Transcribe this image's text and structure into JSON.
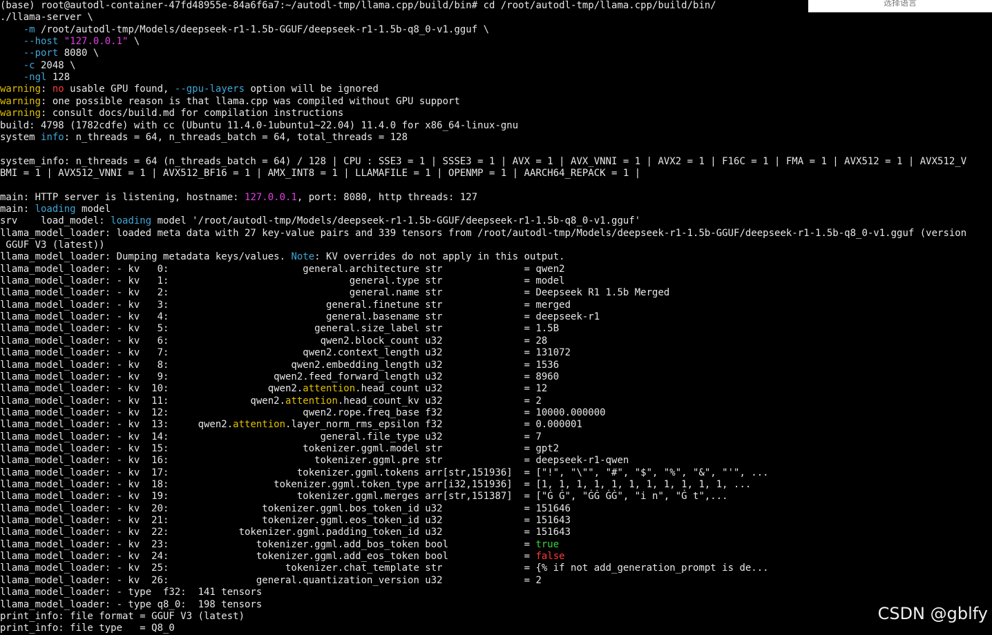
{
  "palette": {
    "default": "#e8e8e8",
    "cyan": "#3fa7d6",
    "yellow": "#e0c000",
    "magenta": "#e040e0",
    "green": "#36d43a",
    "red": "#ff3b3b",
    "orange": "#e08820"
  },
  "language_box_label": "选择语言",
  "watermark": "CSDN @gblfy",
  "lines": [
    [
      {
        "t": "(base) root@autodl-container-47fd48955e-84a6f6a7:~/autodl-tmp/llama.cpp/build/bin# cd /root/autodl-tmp/llama.cpp/build/bin/"
      }
    ],
    [
      {
        "t": "./llama-server \\"
      }
    ],
    [
      {
        "t": "    "
      },
      {
        "t": "-m",
        "c": "cyan"
      },
      {
        "t": " /root/autodl-tmp/Models/deepseek-r1-1.5b-GGUF/deepseek-r1-1.5b-q8_0-v1.gguf \\"
      }
    ],
    [
      {
        "t": "    "
      },
      {
        "t": "--host",
        "c": "cyan"
      },
      {
        "t": " "
      },
      {
        "t": "\"127.0.0.1\"",
        "c": "magenta"
      },
      {
        "t": " \\"
      }
    ],
    [
      {
        "t": "    "
      },
      {
        "t": "--port",
        "c": "cyan"
      },
      {
        "t": " 8080 \\"
      }
    ],
    [
      {
        "t": "    "
      },
      {
        "t": "-c",
        "c": "cyan"
      },
      {
        "t": " 2048 \\"
      }
    ],
    [
      {
        "t": "    "
      },
      {
        "t": "-ngl",
        "c": "cyan"
      },
      {
        "t": " 128"
      }
    ],
    [
      {
        "t": "warning",
        "c": "yellow"
      },
      {
        "t": ": "
      },
      {
        "t": "no",
        "c": "red"
      },
      {
        "t": " usable GPU found, "
      },
      {
        "t": "--gpu-layers",
        "c": "cyan"
      },
      {
        "t": " option will be ignored"
      }
    ],
    [
      {
        "t": "warning",
        "c": "yellow"
      },
      {
        "t": ": one possible reason is that llama.cpp was compiled without GPU support"
      }
    ],
    [
      {
        "t": "warning",
        "c": "yellow"
      },
      {
        "t": ": consult docs/build.md for compilation instructions"
      }
    ],
    [
      {
        "t": "build: 4798 (1782cdfe) with cc (Ubuntu 11.4.0-1ubuntu1~22.04) 11.4.0 for x86_64-linux-gnu"
      }
    ],
    [
      {
        "t": "system "
      },
      {
        "t": "info",
        "c": "cyan"
      },
      {
        "t": ": n_threads = 64, n_threads_batch = 64, total_threads = 128"
      }
    ],
    [
      {
        "t": ""
      }
    ],
    [
      {
        "t": "system_info: n_threads = 64 (n_threads_batch = 64) / 128 | CPU : SSE3 = 1 | SSSE3 = 1 | AVX = 1 | AVX_VNNI = 1 | AVX2 = 1 | F16C = 1 | FMA = 1 | AVX512 = 1 | AVX512_V"
      }
    ],
    [
      {
        "t": "BMI = 1 | AVX512_VNNI = 1 | AVX512_BF16 = 1 | AMX_INT8 = 1 | LLAMAFILE = 1 | OPENMP = 1 | AARCH64_REPACK = 1 |"
      }
    ],
    [
      {
        "t": ""
      }
    ],
    [
      {
        "t": "main: HTTP server is listening, hostname: "
      },
      {
        "t": "127.0.0.1",
        "c": "magenta"
      },
      {
        "t": ", port: 8080, http threads: 127"
      }
    ],
    [
      {
        "t": "main: "
      },
      {
        "t": "loading",
        "c": "cyan"
      },
      {
        "t": " model"
      }
    ],
    [
      {
        "t": "srv    load_model: "
      },
      {
        "t": "loading",
        "c": "cyan"
      },
      {
        "t": " model '/root/autodl-tmp/Models/deepseek-r1-1.5b-GGUF/deepseek-r1-1.5b-q8_0-v1.gguf'"
      }
    ],
    [
      {
        "t": "llama_model_loader: loaded meta data with 27 key-value pairs and 339 tensors from /root/autodl-tmp/Models/deepseek-r1-1.5b-GGUF/deepseek-r1-1.5b-q8_0-v1.gguf (version"
      }
    ],
    [
      {
        "t": " GGUF V3 (latest))"
      }
    ],
    [
      {
        "t": "llama_model_loader: Dumping metadata keys/values. "
      },
      {
        "t": "Note",
        "c": "cyan"
      },
      {
        "t": ": KV overrides do not apply in this output."
      }
    ],
    [
      {
        "t": "llama_model_loader: - kv   0:                       general.architecture str              = qwen2"
      }
    ],
    [
      {
        "t": "llama_model_loader: - kv   1:                               general.type str              = model"
      }
    ],
    [
      {
        "t": "llama_model_loader: - kv   2:                               general.name str              = Deepseek R1 1.5b Merged"
      }
    ],
    [
      {
        "t": "llama_model_loader: - kv   3:                           general.finetune str              = merged"
      }
    ],
    [
      {
        "t": "llama_model_loader: - kv   4:                           general.basename str              = deepseek-r1"
      }
    ],
    [
      {
        "t": "llama_model_loader: - kv   5:                         general.size_label str              = 1.5B"
      }
    ],
    [
      {
        "t": "llama_model_loader: - kv   6:                          qwen2.block_count u32              = 28"
      }
    ],
    [
      {
        "t": "llama_model_loader: - kv   7:                       qwen2.context_length u32              = 131072"
      }
    ],
    [
      {
        "t": "llama_model_loader: - kv   8:                     qwen2.embedding_length u32              = 1536"
      }
    ],
    [
      {
        "t": "llama_model_loader: - kv   9:                  qwen2.feed_forward_length u32              = 8960"
      }
    ],
    [
      {
        "t": "llama_model_loader: - kv  10:                 qwen2."
      },
      {
        "t": "attention",
        "c": "yellow"
      },
      {
        "t": ".head_count u32              = 12"
      }
    ],
    [
      {
        "t": "llama_model_loader: - kv  11:              qwen2."
      },
      {
        "t": "attention",
        "c": "yellow"
      },
      {
        "t": ".head_count_kv u32              = 2"
      }
    ],
    [
      {
        "t": "llama_model_loader: - kv  12:                       qwen2.rope.freq_base f32              = 10000.000000"
      }
    ],
    [
      {
        "t": "llama_model_loader: - kv  13:     qwen2."
      },
      {
        "t": "attention",
        "c": "yellow"
      },
      {
        "t": ".layer_norm_rms_epsilon f32              = 0.000001"
      }
    ],
    [
      {
        "t": "llama_model_loader: - kv  14:                          general.file_type u32              = 7"
      }
    ],
    [
      {
        "t": "llama_model_loader: - kv  15:                       tokenizer.ggml.model str              = gpt2"
      }
    ],
    [
      {
        "t": "llama_model_loader: - kv  16:                         tokenizer.ggml.pre str              = deepseek-r1-qwen"
      }
    ],
    [
      {
        "t": "llama_model_loader: - kv  17:                      tokenizer.ggml.tokens arr[str,151936]  = [\"!\", \"\\\"\", \"#\", \"$\", \"%\", \"&\", \"'\", ..."
      }
    ],
    [
      {
        "t": "llama_model_loader: - kv  18:                  tokenizer.ggml.token_type arr[i32,151936]  = [1, 1, 1, 1, 1, 1, 1, 1, 1, 1, 1, ..."
      }
    ],
    [
      {
        "t": "llama_model_loader: - kv  19:                      tokenizer.ggml.merges arr[str,151387]  = [\"Ġ Ġ\", \"ĠĠ ĠĠ\", \"i n\", \"Ġ t\",..."
      }
    ],
    [
      {
        "t": "llama_model_loader: - kv  20:                tokenizer.ggml.bos_token_id u32              = 151646"
      }
    ],
    [
      {
        "t": "llama_model_loader: - kv  21:                tokenizer.ggml.eos_token_id u32              = 151643"
      }
    ],
    [
      {
        "t": "llama_model_loader: - kv  22:            tokenizer.ggml.padding_token_id u32              = 151643"
      }
    ],
    [
      {
        "t": "llama_model_loader: - kv  23:               tokenizer.ggml.add_bos_token bool             = "
      },
      {
        "t": "true",
        "c": "green"
      }
    ],
    [
      {
        "t": "llama_model_loader: - kv  24:               tokenizer.ggml.add_eos_token bool             = "
      },
      {
        "t": "false",
        "c": "red"
      }
    ],
    [
      {
        "t": "llama_model_loader: - kv  25:                    tokenizer.chat_template str              = {% if not add_generation_prompt is de..."
      }
    ],
    [
      {
        "t": "llama_model_loader: - kv  26:               general.quantization_version u32              = 2"
      }
    ],
    [
      {
        "t": "llama_model_loader: - type  f32:  141 tensors"
      }
    ],
    [
      {
        "t": "llama_model_loader: - type q8_0:  198 tensors"
      }
    ],
    [
      {
        "t": "print_info: file format = GGUF V3 (latest)"
      }
    ],
    [
      {
        "t": "print_info: file type   = Q8_0"
      }
    ]
  ]
}
